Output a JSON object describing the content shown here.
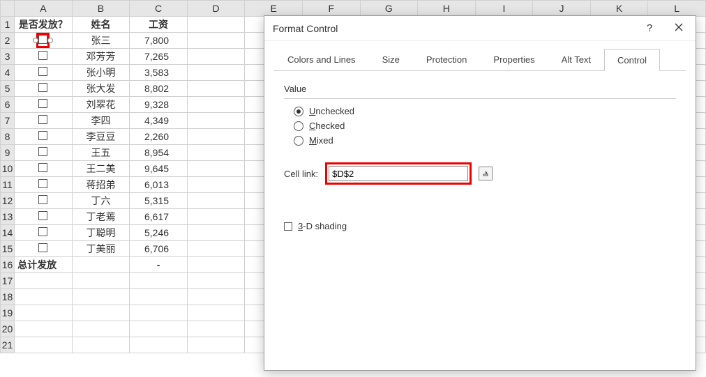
{
  "columns": [
    "A",
    "B",
    "C",
    "D",
    "E",
    "F",
    "G",
    "H",
    "I",
    "J",
    "K",
    "L"
  ],
  "header_row": {
    "A": "是否发放？",
    "B": "姓名",
    "C": "工资"
  },
  "rows": [
    {
      "B": "张三",
      "C": "7,800"
    },
    {
      "B": "邓芳芳",
      "C": "7,265"
    },
    {
      "B": "张小明",
      "C": "3,583"
    },
    {
      "B": "张大发",
      "C": "8,802"
    },
    {
      "B": "刘翠花",
      "C": "9,328"
    },
    {
      "B": "李四",
      "C": "4,349"
    },
    {
      "B": "李豆豆",
      "C": "2,260"
    },
    {
      "B": "王五",
      "C": "8,954"
    },
    {
      "B": "王二美",
      "C": "9,645"
    },
    {
      "B": "蒋招弟",
      "C": "6,013"
    },
    {
      "B": "丁六",
      "C": "5,315"
    },
    {
      "B": "丁老蔫",
      "C": "6,617"
    },
    {
      "B": "丁聪明",
      "C": "5,246"
    },
    {
      "B": "丁美丽",
      "C": "6,706"
    }
  ],
  "total_row": {
    "A": "总计发放",
    "C": "-"
  },
  "dialog": {
    "title": "Format Control",
    "help": "?",
    "tabs": [
      "Colors and Lines",
      "Size",
      "Protection",
      "Properties",
      "Alt Text",
      "Control"
    ],
    "active_tab": "Control",
    "value_label": "Value",
    "radio_unchecked": "Unchecked",
    "radio_checked": "Checked",
    "radio_mixed": "Mixed",
    "cell_link_label": "Cell link:",
    "cell_link_value": "$D$2",
    "shading_label": "3-D shading"
  }
}
